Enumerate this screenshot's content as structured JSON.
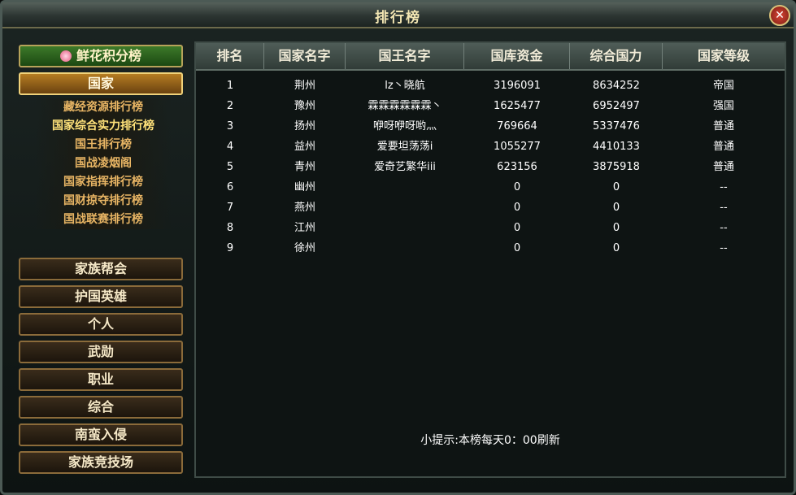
{
  "window": {
    "title": "排行榜",
    "close_glyph": "✕"
  },
  "sidebar": {
    "flower_board": "鲜花积分榜",
    "country_tab": "国家",
    "sub_items": [
      "藏经资源排行榜",
      "国家综合实力排行榜",
      "国王排行榜",
      "国战凌烟阁",
      "国家指挥排行榜",
      "国财掠夺排行榜",
      "国战联赛排行榜"
    ],
    "active_sub_index": 1,
    "categories": [
      "家族帮会",
      "护国英雄",
      "个人",
      "武勋",
      "职业",
      "综合",
      "南蛮入侵",
      "家族竞技场"
    ]
  },
  "table": {
    "headers": [
      "排名",
      "国家名字",
      "国王名字",
      "国库资金",
      "综合国力",
      "国家等级"
    ],
    "rows": [
      [
        "1",
        "荆州",
        "lz丶晓航",
        "3196091",
        "8634252",
        "帝国"
      ],
      [
        "2",
        "豫州",
        "霖霖霖霖霖霖丶",
        "1625477",
        "6952497",
        "强国"
      ],
      [
        "3",
        "扬州",
        "咿呀咿呀哟灬",
        "769664",
        "5337476",
        "普通"
      ],
      [
        "4",
        "益州",
        "爱要坦荡荡i",
        "1055277",
        "4410133",
        "普通"
      ],
      [
        "5",
        "青州",
        "爱奇艺繁华iii",
        "623156",
        "3875918",
        "普通"
      ],
      [
        "6",
        "幽州",
        "",
        "0",
        "0",
        "--"
      ],
      [
        "7",
        "燕州",
        "",
        "0",
        "0",
        "--"
      ],
      [
        "8",
        "江州",
        "",
        "0",
        "0",
        "--"
      ],
      [
        "9",
        "徐州",
        "",
        "0",
        "0",
        "--"
      ]
    ]
  },
  "tip": "小提示:本榜每天0：00刷新"
}
